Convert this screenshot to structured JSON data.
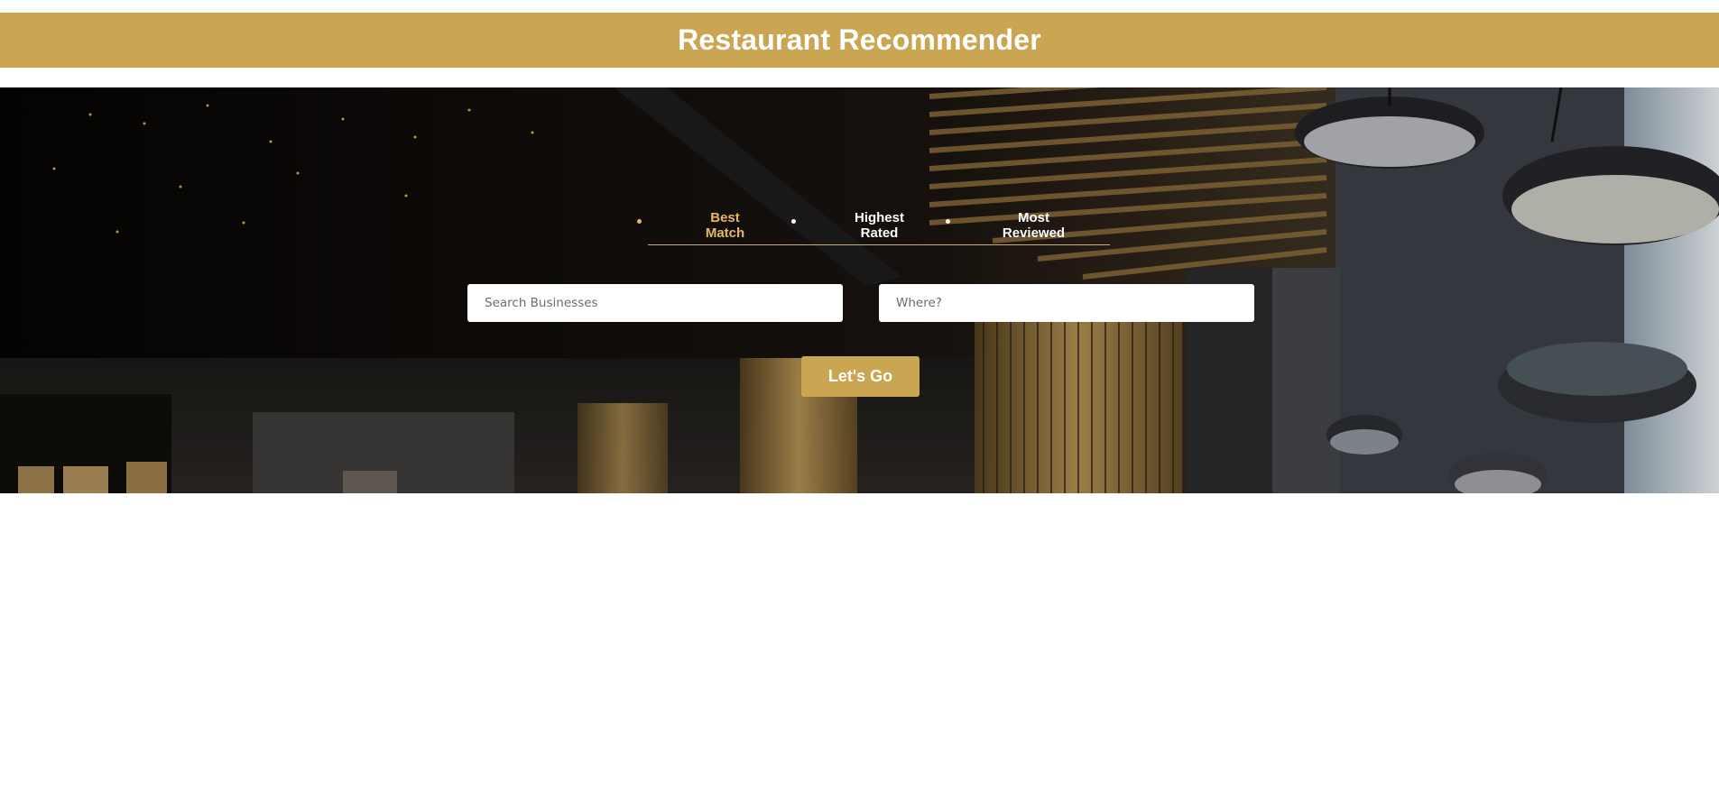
{
  "header": {
    "title": "Restaurant Recommender",
    "background_color": "#caa552"
  },
  "hero": {
    "background_image": "restaurant-interior-photo"
  },
  "sort_options": [
    {
      "label": "Best Match",
      "active": true
    },
    {
      "label": "Highest Rated",
      "active": false
    },
    {
      "label": "Most Reviewed",
      "active": false
    }
  ],
  "search": {
    "business_placeholder": "Search Businesses",
    "location_placeholder": "Where?",
    "business_value": "",
    "location_value": "",
    "submit_label": "Let's Go"
  },
  "colors": {
    "accent": "#caa552",
    "active_sort": "#e8b768"
  }
}
